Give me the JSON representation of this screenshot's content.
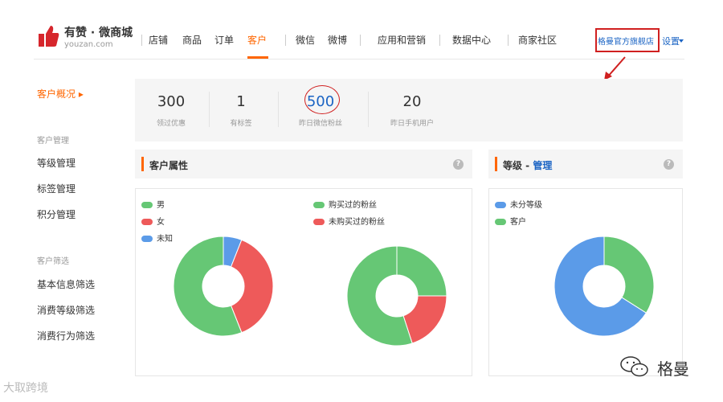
{
  "header": {
    "brand_name": "有赞 · 微商城",
    "brand_sub": "youzan.com",
    "nav_items": [
      {
        "label": "店铺"
      },
      {
        "label": "商品"
      },
      {
        "label": "订单"
      },
      {
        "label": "客户"
      },
      {
        "label": "微信"
      },
      {
        "label": "微博"
      },
      {
        "label": "应用和营销"
      },
      {
        "label": "数据中心"
      },
      {
        "label": "商家社区"
      }
    ],
    "active_nav": "客户",
    "store_name": "格曼官方旗舰店",
    "settings_label": "设置"
  },
  "sidebar": {
    "overview": "客户概况 ▸",
    "sections": [
      {
        "heading": "客户管理",
        "items": [
          {
            "label": "等级管理"
          },
          {
            "label": "标签管理"
          },
          {
            "label": "积分管理"
          }
        ]
      },
      {
        "heading": "客户筛选",
        "items": [
          {
            "label": "基本信息筛选"
          },
          {
            "label": "消费等级筛选"
          },
          {
            "label": "消费行为筛选"
          }
        ]
      }
    ]
  },
  "stats": [
    {
      "value": "300",
      "label": "领过优惠"
    },
    {
      "value": "1",
      "label": "有标签"
    },
    {
      "value": "500",
      "label": "昨日微信粉丝"
    },
    {
      "value": "20",
      "label": "昨日手机用户"
    }
  ],
  "attributes_section": {
    "title": "客户属性",
    "help": "?"
  },
  "level_section": {
    "title": "等级 - ",
    "link": "管理",
    "help": "?"
  },
  "colors": {
    "green": "#66c775",
    "red": "#ee5a5a",
    "blue": "#5b9be8",
    "accent": "#ff6600",
    "link": "#1b64c4"
  },
  "chart_data": [
    {
      "type": "pie",
      "legend": [
        {
          "name": "男",
          "color": "#66c775"
        },
        {
          "name": "女",
          "color": "#ee5a5a"
        },
        {
          "name": "未知",
          "color": "#5b9be8"
        }
      ],
      "slices": [
        {
          "name": "未知",
          "value": 6,
          "color": "#5b9be8"
        },
        {
          "name": "女",
          "value": 38,
          "color": "#ee5a5a"
        },
        {
          "name": "男",
          "value": 56,
          "color": "#66c775"
        }
      ]
    },
    {
      "type": "pie",
      "legend": [
        {
          "name": "购买过的粉丝",
          "color": "#66c775"
        },
        {
          "name": "未购买过的粉丝",
          "color": "#ee5a5a"
        }
      ],
      "slices": [
        {
          "name": "购买过的粉丝",
          "value": 25,
          "color": "#66c775"
        },
        {
          "name": "未购买过的粉丝",
          "value": 20,
          "color": "#ee5a5a"
        },
        {
          "name": "购买过的粉丝",
          "value": 55,
          "color": "#66c775"
        }
      ]
    },
    {
      "type": "pie",
      "legend": [
        {
          "name": "未分等级",
          "color": "#5b9be8"
        },
        {
          "name": "客户",
          "color": "#66c775"
        }
      ],
      "slices": [
        {
          "name": "客户",
          "value": 34,
          "color": "#66c775"
        },
        {
          "name": "未分等级",
          "value": 66,
          "color": "#5b9be8"
        }
      ]
    }
  ],
  "watermarks": {
    "left": "大取跨境",
    "right": "格曼"
  }
}
